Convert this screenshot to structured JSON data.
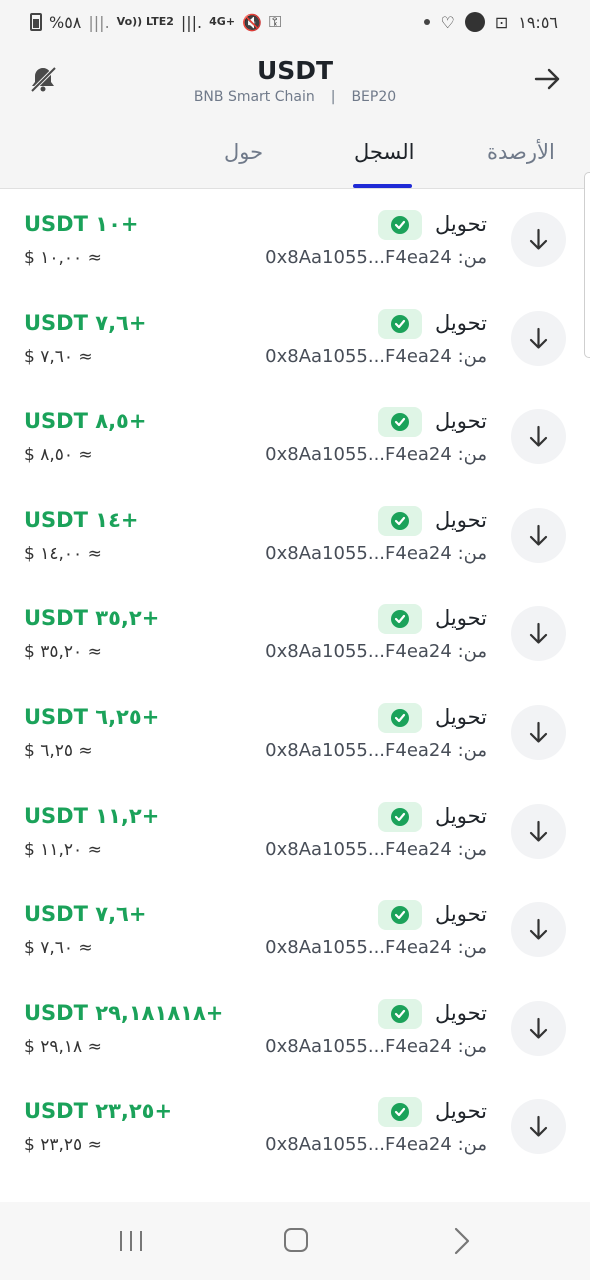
{
  "status_bar": {
    "battery": "%٥٨",
    "network": "Vo)) LTE2",
    "net_type": "4G+",
    "time": "١٩:٥٦"
  },
  "header": {
    "title": "USDT",
    "chain": "BNB Smart Chain",
    "separator": "|",
    "standard": "BEP20"
  },
  "tabs": [
    {
      "label": "حول",
      "active": false
    },
    {
      "label": "السجل",
      "active": true
    },
    {
      "label": "الأرصدة",
      "active": false
    }
  ],
  "colors": {
    "accent": "#1f2ad6",
    "positive": "#1ba25a",
    "badge_bg": "#dff5e6"
  },
  "icons": {
    "left_header": "bell-off-icon",
    "right_header": "arrow-right-icon",
    "row": "arrow-down-icon",
    "status": "check-circle-icon"
  },
  "transactions": [
    {
      "type": "تحويل",
      "amount": "USDT ١٠+",
      "usd": "$ ١٠,٠٠ ≈",
      "from_label": "من:",
      "from_addr": "0x8Aa1055...F4ea24"
    },
    {
      "type": "تحويل",
      "amount": "USDT ٧,٦+",
      "usd": "$ ٧,٦٠ ≈",
      "from_label": "من:",
      "from_addr": "0x8Aa1055...F4ea24"
    },
    {
      "type": "تحويل",
      "amount": "USDT ٨,٥+",
      "usd": "$ ٨,٥٠ ≈",
      "from_label": "من:",
      "from_addr": "0x8Aa1055...F4ea24"
    },
    {
      "type": "تحويل",
      "amount": "USDT ١٤+",
      "usd": "$ ١٤,٠٠ ≈",
      "from_label": "من:",
      "from_addr": "0x8Aa1055...F4ea24"
    },
    {
      "type": "تحويل",
      "amount": "USDT ٣٥,٢+",
      "usd": "$ ٣٥,٢٠ ≈",
      "from_label": "من:",
      "from_addr": "0x8Aa1055...F4ea24"
    },
    {
      "type": "تحويل",
      "amount": "USDT ٦,٢٥+",
      "usd": "$ ٦,٢٥ ≈",
      "from_label": "من:",
      "from_addr": "0x8Aa1055...F4ea24"
    },
    {
      "type": "تحويل",
      "amount": "USDT ١١,٢+",
      "usd": "$ ١١,٢٠ ≈",
      "from_label": "من:",
      "from_addr": "0x8Aa1055...F4ea24"
    },
    {
      "type": "تحويل",
      "amount": "USDT ٧,٦+",
      "usd": "$ ٧,٦٠ ≈",
      "from_label": "من:",
      "from_addr": "0x8Aa1055...F4ea24"
    },
    {
      "type": "تحويل",
      "amount": "USDT ٢٩,١٨١٨١٨+",
      "usd": "$ ٢٩,١٨ ≈",
      "from_label": "من:",
      "from_addr": "0x8Aa1055...F4ea24"
    },
    {
      "type": "تحويل",
      "amount": "USDT ٢٣,٢٥+",
      "usd": "$ ٢٣,٢٥ ≈",
      "from_label": "من:",
      "from_addr": "0x8Aa1055...F4ea24"
    }
  ]
}
